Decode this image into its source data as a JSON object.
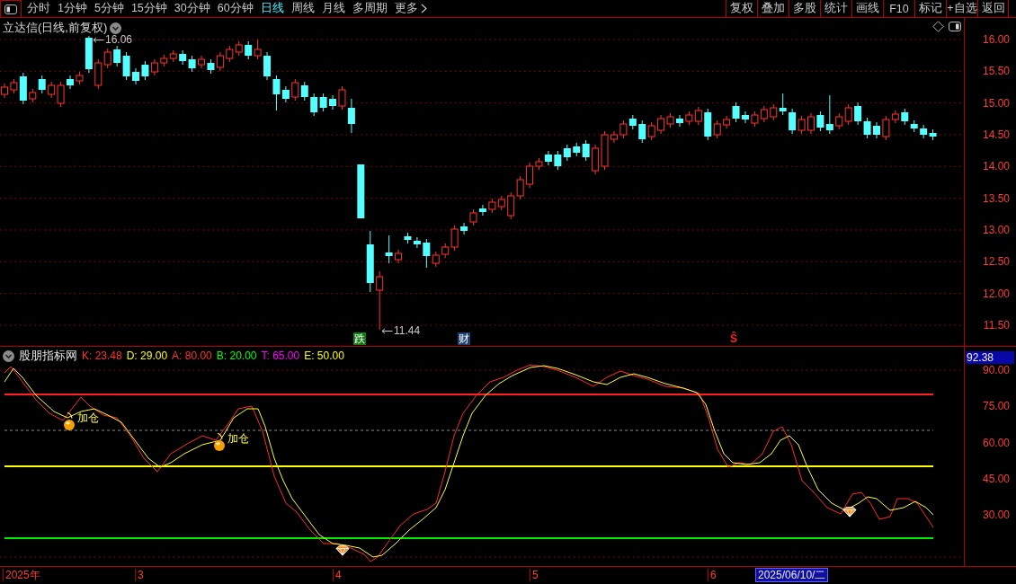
{
  "toolbar": {
    "periods": [
      {
        "label": "分时",
        "selected": false,
        "kind": "period"
      },
      {
        "label": "1分钟",
        "selected": false,
        "kind": "period"
      },
      {
        "label": "5分钟",
        "selected": false,
        "kind": "period"
      },
      {
        "label": "15分钟",
        "selected": false,
        "kind": "period"
      },
      {
        "label": "30分钟",
        "selected": false,
        "kind": "period"
      },
      {
        "label": "60分钟",
        "selected": false,
        "kind": "period"
      },
      {
        "label": "日线",
        "selected": true,
        "kind": "period"
      },
      {
        "label": "周线",
        "selected": false,
        "kind": "period"
      },
      {
        "label": "月线",
        "selected": false,
        "kind": "period"
      },
      {
        "label": "多周期",
        "selected": false,
        "kind": "period"
      },
      {
        "label": "更多",
        "selected": false,
        "kind": "menu"
      }
    ],
    "buttons": [
      "复权",
      "叠加",
      "多股",
      "统计",
      "画线",
      "F10",
      "标记",
      "+自选",
      "返回"
    ]
  },
  "price_panel": {
    "title": "立达信(日线,前复权)",
    "high_label": "16.06",
    "low_label": "11.44",
    "signals": [
      {
        "label": "跌",
        "kind": "tag",
        "color": "#127a12"
      },
      {
        "label": "财",
        "kind": "tag",
        "color": "#1c3f72"
      },
      {
        "label": "Ŝ",
        "kind": "letter",
        "color": "#ff2020"
      }
    ],
    "axis_labels": [
      "16.00",
      "15.50",
      "15.00",
      "14.50",
      "14.00",
      "13.50",
      "13.00",
      "12.50",
      "12.00",
      "11.50"
    ]
  },
  "indicator_panel": {
    "name": "股朋指标网",
    "values": [
      {
        "label": "K: 23.48",
        "color": "#ff3232"
      },
      {
        "label": "D: 29.00",
        "color": "#ffff00"
      },
      {
        "label": "A: 80.00",
        "color": "#ff3030"
      },
      {
        "label": "B: 20.00",
        "color": "#00ff00"
      },
      {
        "label": "T: 65.00",
        "color": "#ff00ff"
      },
      {
        "label": "E: 50.00",
        "color": "#fffe00"
      }
    ],
    "markers": [
      {
        "kind": "add",
        "label": "加仓"
      },
      {
        "kind": "add",
        "label": "加仓"
      },
      {
        "kind": "gem"
      },
      {
        "kind": "gem"
      }
    ],
    "current_value": "92.38",
    "axis_labels": [
      "90.00",
      "75.00",
      "60.00",
      "45.00",
      "30.00"
    ]
  },
  "time_axis": {
    "labels": [
      "2025年",
      "3",
      "4",
      "5",
      "6"
    ],
    "cursor_date": "2025/06/10/二"
  }
}
